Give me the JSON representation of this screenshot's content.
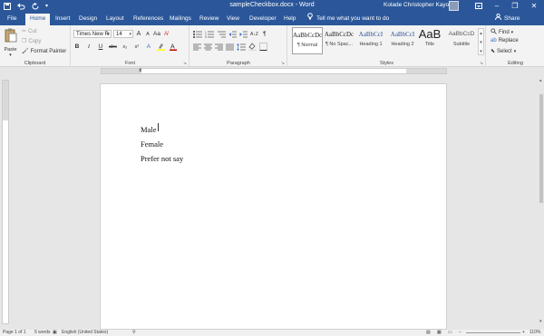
{
  "app": {
    "title": "sampleCheckbox.docx - Word",
    "user": "Kolade Christopher Kayode"
  },
  "window_controls": [
    "–",
    "❐",
    "✕"
  ],
  "tabs": [
    "File",
    "Home",
    "Insert",
    "Design",
    "Layout",
    "References",
    "Mailings",
    "Review",
    "View",
    "Developer",
    "Help"
  ],
  "active_tab": "Home",
  "tell_me": "Tell me what you want to do",
  "share": "Share",
  "clipboard": {
    "paste": "Paste",
    "cut": "Cut",
    "copy": "Copy",
    "format_painter": "Format Painter",
    "label": "Clipboard"
  },
  "font": {
    "name": "Times New R",
    "size": "14",
    "label": "Font",
    "grow": "A",
    "shrink": "A",
    "case": "Aa",
    "bold": "B",
    "italic": "I",
    "underline": "U",
    "strike": "abc",
    "sub": "x₂",
    "sup": "x²"
  },
  "paragraph": {
    "label": "Paragraph",
    "pilcrow": "¶"
  },
  "styles": {
    "label": "Styles",
    "items": [
      {
        "sample": "AaBbCcDc",
        "name": "¶ Normal"
      },
      {
        "sample": "AaBbCcDc",
        "name": "¶ No Spac..."
      },
      {
        "sample": "AaBbCcI",
        "name": "Heading 1"
      },
      {
        "sample": "AaBbCcI",
        "name": "Heading 2"
      },
      {
        "sample": "AaB",
        "name": "Title"
      },
      {
        "sample": "AaBbCcD",
        "name": "Subtitle"
      }
    ]
  },
  "editing": {
    "find": "Find",
    "replace": "Replace",
    "select": "Select",
    "label": "Editing"
  },
  "document": {
    "lines": [
      "Male",
      "Female",
      "Prefer not say"
    ]
  },
  "status": {
    "page": "Page 1 of 1",
    "words": "5 words",
    "language": "English (United States)",
    "zoom": "110%"
  },
  "colors": {
    "brand": "#2b579a",
    "font_color": "#c00000",
    "highlight": "#ffff00"
  }
}
